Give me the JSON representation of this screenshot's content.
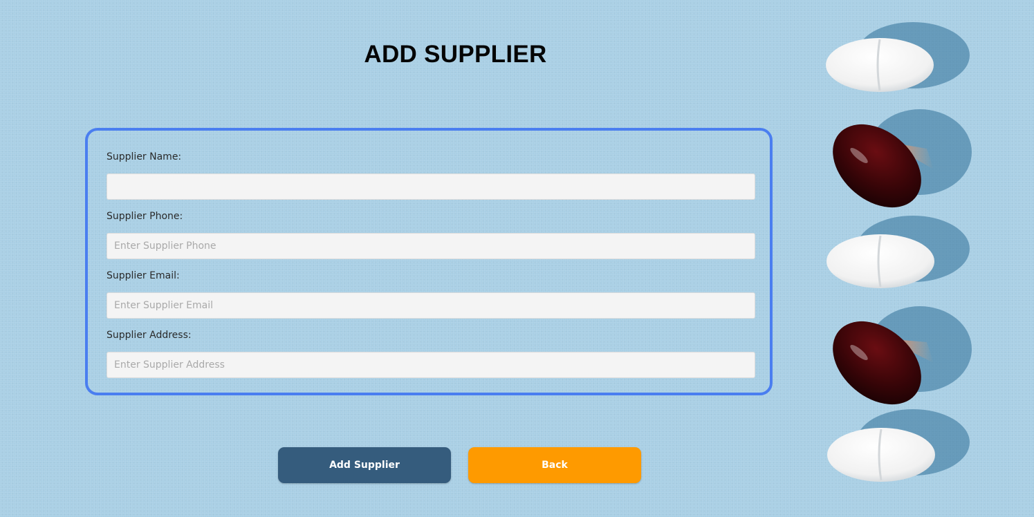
{
  "page": {
    "title": "ADD SUPPLIER"
  },
  "form": {
    "fields": [
      {
        "label": "Supplier Name:",
        "value": "",
        "placeholder": ""
      },
      {
        "label": "Supplier Phone:",
        "value": "",
        "placeholder": "Enter Supplier Phone"
      },
      {
        "label": "Supplier Email:",
        "value": "",
        "placeholder": "Enter Supplier Email"
      },
      {
        "label": "Supplier Address:",
        "value": "",
        "placeholder": "Enter Supplier Address"
      }
    ]
  },
  "actions": {
    "add_label": "Add Supplier",
    "back_label": "Back"
  },
  "colors": {
    "background": "#a9cfe5",
    "panel_border": "#4a7ef0",
    "add_button": "#355c7d",
    "back_button": "#fe9a00",
    "input_fill": "#f4f4f4"
  },
  "decoration": {
    "image": "pills-photo",
    "items": [
      "white-tablet",
      "red-softgel-capsule",
      "white-tablet",
      "red-softgel-capsule",
      "white-tablet"
    ]
  }
}
